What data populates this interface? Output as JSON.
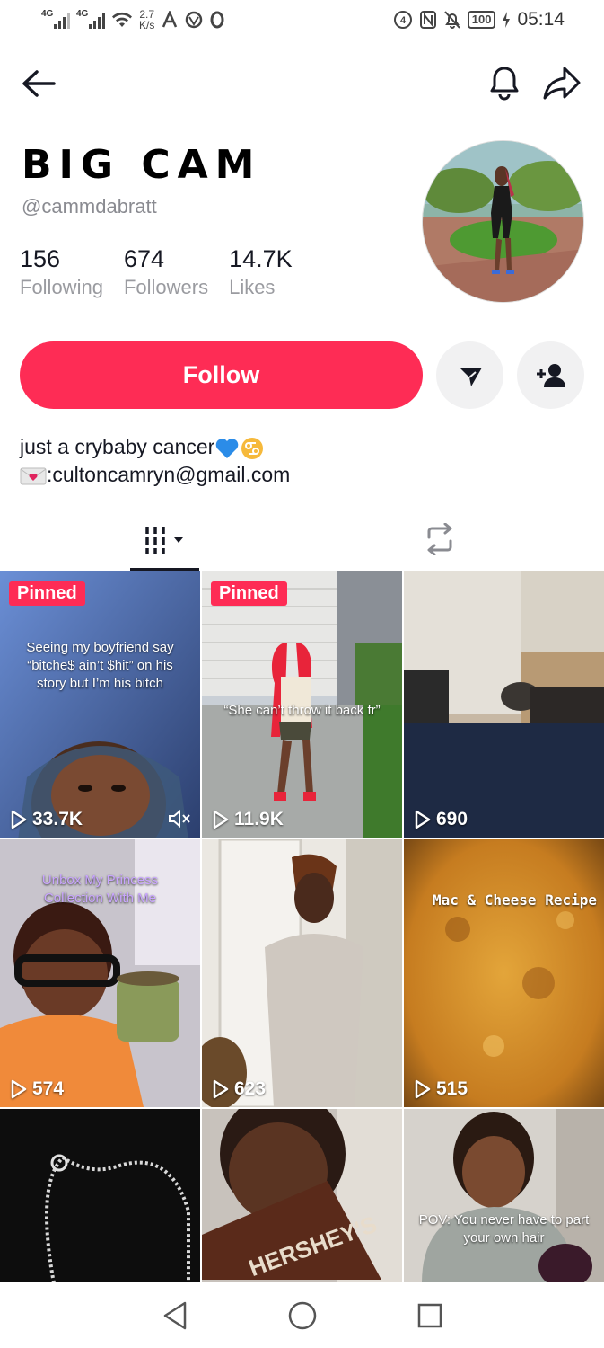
{
  "status_bar": {
    "signal1_label": "4G",
    "signal2_label": "4G",
    "speed_value": "2.7",
    "speed_unit": "K/s",
    "battery": "100",
    "time": "05:14"
  },
  "profile": {
    "display_name": "BIG CAM",
    "username": "@cammdabratt",
    "stats": [
      {
        "value": "156",
        "label": "Following"
      },
      {
        "value": "674",
        "label": "Followers"
      },
      {
        "value": "14.7K",
        "label": "Likes"
      }
    ],
    "follow_label": "Follow",
    "bio_line1": "just a crybaby cancer",
    "bio_line2": ":cultoncamryn@gmail.com"
  },
  "videos": [
    {
      "pinned": "Pinned",
      "caption": "Seeing my boyfriend say “bitche$ ain’t $hit” on his story but I’m his bitch",
      "views": "33.7K"
    },
    {
      "pinned": "Pinned",
      "caption": "“She can’t throw it back fr” ",
      "views": "11.9K"
    },
    {
      "pinned": "",
      "caption": "",
      "views": "690"
    },
    {
      "pinned": "",
      "caption": "Unbox My Princess Collection With Me",
      "views": "574"
    },
    {
      "pinned": "",
      "caption": "",
      "views": "623"
    },
    {
      "pinned": "",
      "caption": "Mac & Cheese Recipe",
      "views": "515"
    },
    {
      "pinned": "",
      "caption": "",
      "views": ""
    },
    {
      "pinned": "",
      "caption": "",
      "views": ""
    },
    {
      "pinned": "",
      "caption": "POV: You never have to part your own hair",
      "views": ""
    }
  ],
  "colors": {
    "accent": "#fe2c55",
    "text": "#161823",
    "secondary_text": "#8a8b91",
    "button_bg": "#f1f1f2"
  }
}
